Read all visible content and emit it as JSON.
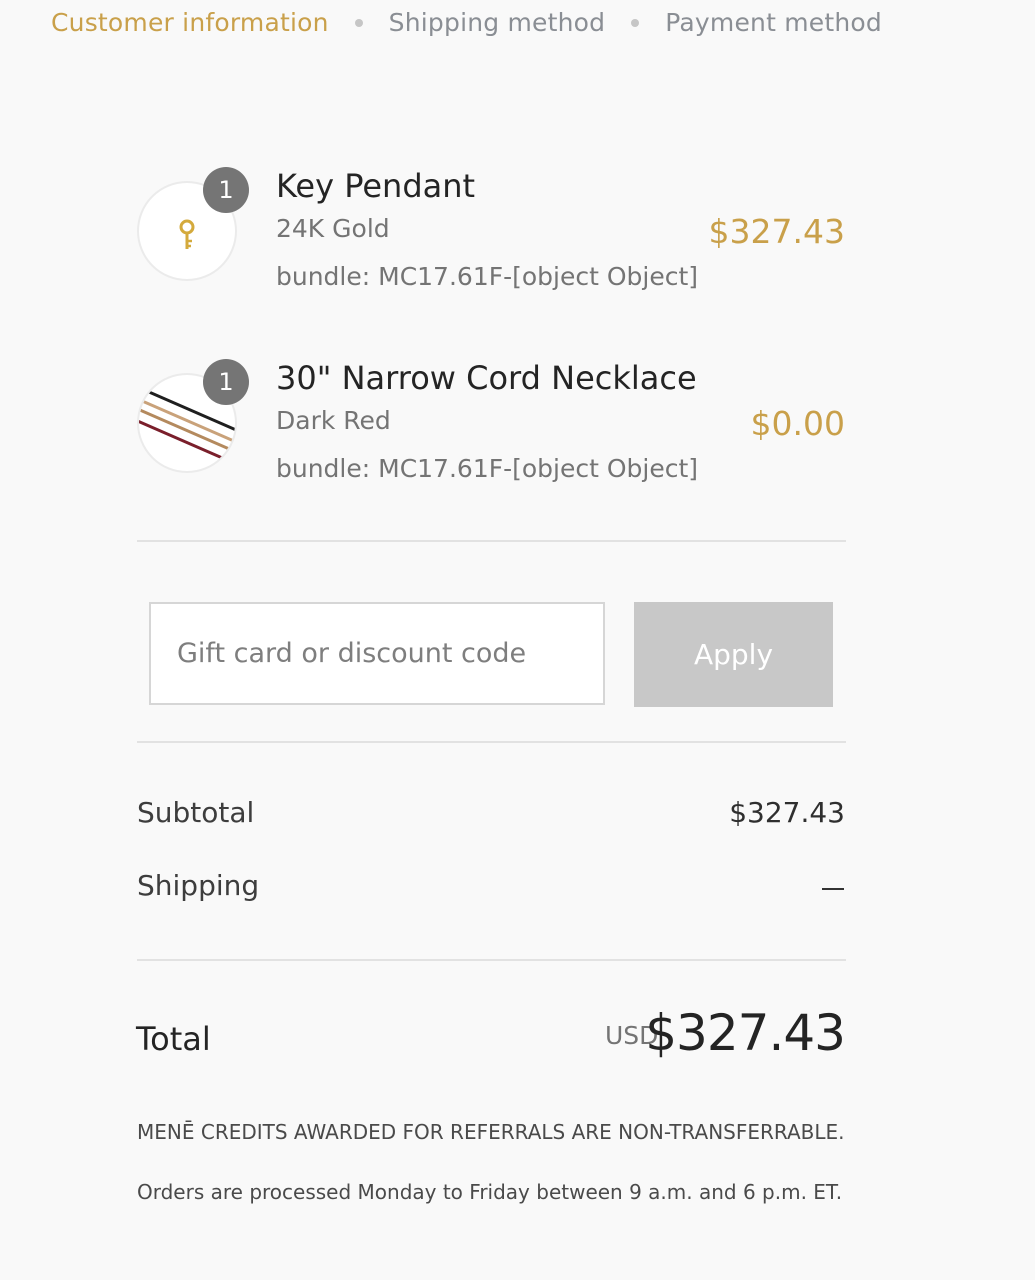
{
  "breadcrumbs": [
    "Customer information",
    "Shipping method",
    "Payment method"
  ],
  "items": [
    {
      "quantity": "1",
      "name": "Key Pendant",
      "variant": "24K Gold",
      "bundle": "bundle: MC17.61F-[object Object]",
      "price": "$327.43",
      "thumbnail_icon": "key-pendant-thumbnail"
    },
    {
      "quantity": "1",
      "name": "30\" Narrow Cord Necklace",
      "variant": "Dark Red",
      "bundle": "bundle: MC17.61F-[object Object]",
      "price": "$0.00",
      "thumbnail_icon": "cord-necklace-thumbnail"
    }
  ],
  "discount": {
    "placeholder": "Gift card or discount code",
    "button_label": "Apply"
  },
  "summary": {
    "subtotal_label": "Subtotal",
    "subtotal_value": "$327.43",
    "shipping_label": "Shipping",
    "shipping_value": "—"
  },
  "total": {
    "label": "Total",
    "currency": "USD",
    "value": "$327.43"
  },
  "notes": [
    "MENĒ CREDITS AWARDED FOR REFERRALS ARE NON-TRANSFERRABLE.",
    "Orders are processed Monday to Friday between 9 a.m. and 6 p.m. ET."
  ],
  "colors": {
    "accent": "#c9a04a",
    "background": "#f9f9f9",
    "badge": "#757575",
    "button_disabled": "#c8c8c8"
  }
}
